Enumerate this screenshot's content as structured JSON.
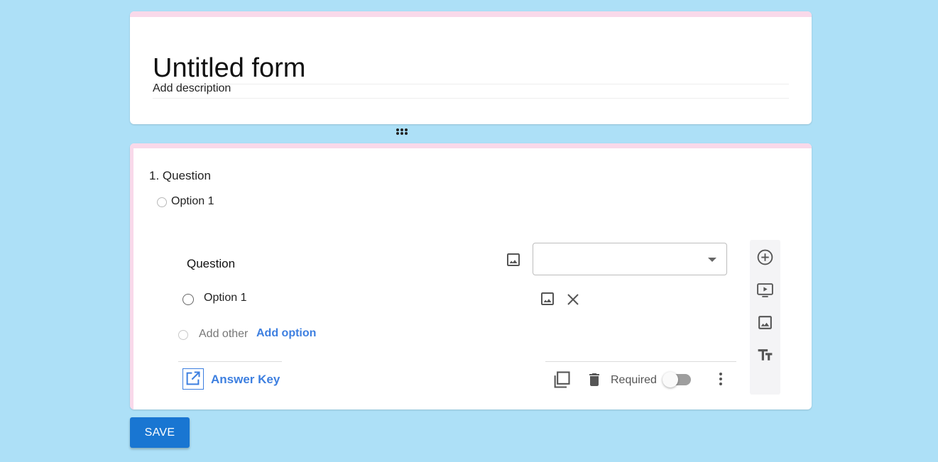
{
  "form": {
    "title": "Untitled form",
    "description": "Add description"
  },
  "preview": {
    "question_title": "1. Question",
    "option_label": "Option 1"
  },
  "editor": {
    "question_label": "Question",
    "question_type_value": "",
    "options": [
      {
        "label": "Option 1"
      }
    ],
    "add_other_label": "Add other",
    "add_option_label": "Add option",
    "answer_key_label": "Answer Key",
    "required_label": "Required",
    "required_on": false
  },
  "side_toolbar": {
    "icons": [
      "add-question-icon",
      "add-video-icon",
      "add-image-icon",
      "add-title-icon"
    ]
  },
  "actions": {
    "save_label": "SAVE"
  },
  "colors": {
    "background": "#ade0f7",
    "accent_bar": "#f9d9ea",
    "link_blue": "#3d7fe0",
    "save_button": "#1976d2"
  }
}
